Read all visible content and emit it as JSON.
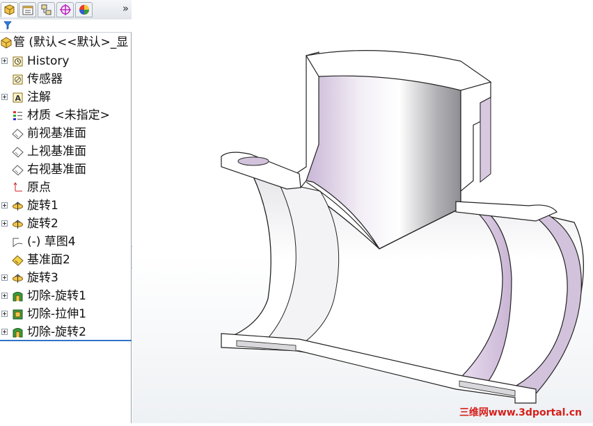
{
  "panel": {
    "tabs": [
      {
        "icon": "feature-manager-icon",
        "active": true
      },
      {
        "icon": "property-manager-icon"
      },
      {
        "icon": "configuration-manager-icon"
      },
      {
        "icon": "dimxpert-manager-icon"
      },
      {
        "icon": "display-manager-icon"
      }
    ],
    "more": "»",
    "filter_icon": "filter-icon"
  },
  "tree": {
    "root": "管  (默认<<默认>_显",
    "items": [
      {
        "label": "History",
        "icon": "history-icon",
        "expandable": true
      },
      {
        "label": "传感器",
        "icon": "sensor-icon",
        "expandable": false
      },
      {
        "label": "注解",
        "icon": "annotation-icon",
        "expandable": true
      },
      {
        "label": "材质 <未指定>",
        "icon": "material-icon",
        "expandable": false
      },
      {
        "label": "前视基准面",
        "icon": "plane-icon",
        "expandable": false
      },
      {
        "label": "上视基准面",
        "icon": "plane-icon",
        "expandable": false
      },
      {
        "label": "右视基准面",
        "icon": "plane-icon",
        "expandable": false
      },
      {
        "label": "原点",
        "icon": "origin-icon",
        "expandable": false
      },
      {
        "label": "旋转1",
        "icon": "revolve-icon",
        "expandable": true
      },
      {
        "label": "旋转2",
        "icon": "revolve-icon",
        "expandable": true
      },
      {
        "label": "(-) 草图4",
        "icon": "sketch-icon",
        "expandable": false
      },
      {
        "label": "基准面2",
        "icon": "plane-yellow-icon",
        "expandable": false
      },
      {
        "label": "旋转3",
        "icon": "revolve-icon",
        "expandable": true
      },
      {
        "label": "切除-旋转1",
        "icon": "cut-revolve-icon",
        "expandable": true
      },
      {
        "label": "切除-拉伸1",
        "icon": "cut-extrude-icon",
        "expandable": true
      },
      {
        "label": "切除-旋转2",
        "icon": "cut-revolve-icon",
        "expandable": true
      }
    ]
  },
  "viewport": {
    "model_name": "pipe-tee-section-model",
    "watermark": "三维网www.3dportal.cn"
  },
  "colors": {
    "panel_border": "#9aa3ad",
    "accent_line": "#2e74c8",
    "model_inner": "#c9b8d2",
    "watermark": "#d4201b"
  }
}
